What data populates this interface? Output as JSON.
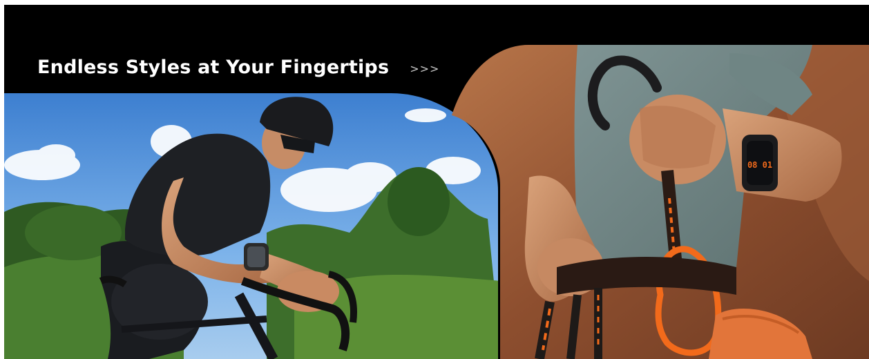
{
  "banner": {
    "headline": "Endless Styles at Your Fingertips",
    "more_link": ">>>",
    "watch_display": "08 01"
  },
  "colors": {
    "background": "#000000",
    "headline": "#ffffff",
    "sky": "#4f8fd6",
    "foliage": "#3f6a2a",
    "rock": "#9a5a36",
    "harness_orange": "#f26a1b"
  },
  "panels": [
    {
      "name": "cycling-photo",
      "icon": "cyclist-with-smartwatch"
    },
    {
      "name": "climbing-photo",
      "icon": "climber-with-carabiner-and-smartwatch"
    }
  ]
}
